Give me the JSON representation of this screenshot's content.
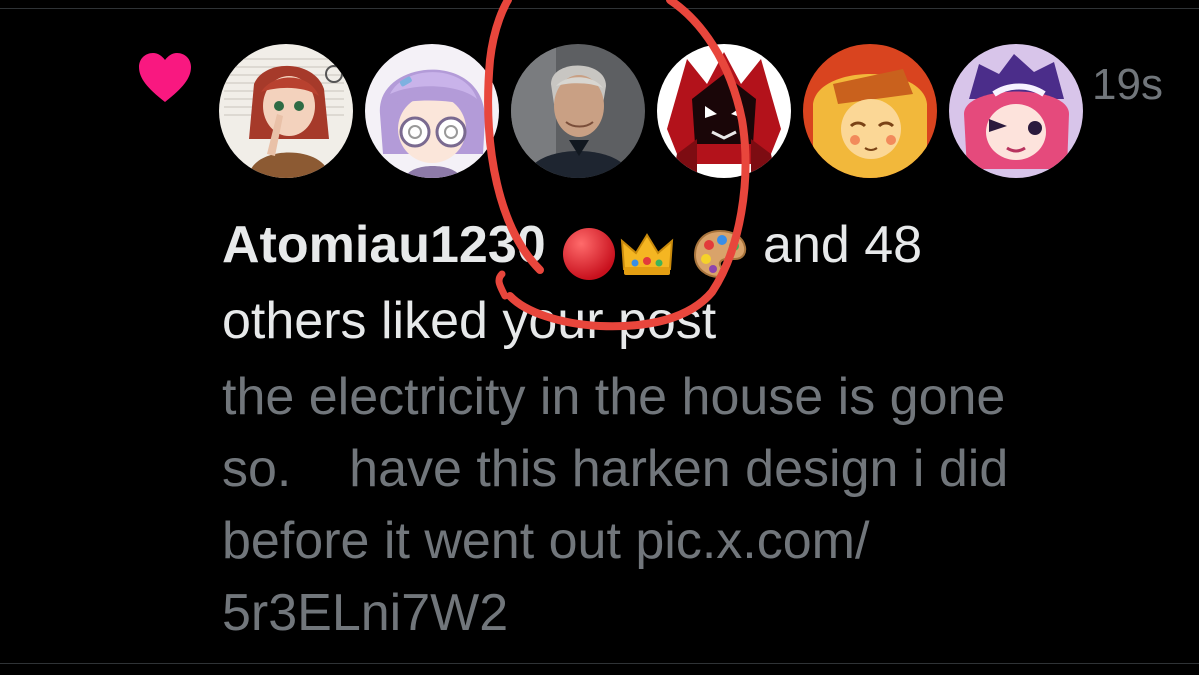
{
  "colors": {
    "background": "#000000",
    "heart": "#f91880",
    "primary_text": "#e7e9ea",
    "secondary_text": "#71767b",
    "annotation_red": "#e8463c"
  },
  "notification": {
    "icon": "heart-icon",
    "timestamp": "19s",
    "avatars": [
      {
        "name": "avatar-1",
        "description": "red-haired girl drawing"
      },
      {
        "name": "avatar-2",
        "description": "lavender-haired character with glasses"
      },
      {
        "name": "avatar-3",
        "description": "photo of a man"
      },
      {
        "name": "avatar-4",
        "description": "red dark character drawing"
      },
      {
        "name": "avatar-5",
        "description": "orange-haired character drawing"
      },
      {
        "name": "avatar-6",
        "description": "pink and purple character drawing"
      }
    ],
    "username": "Atomiau1230",
    "badges": [
      "red-circle-emoji",
      "crown-emoji",
      "artist-palette-emoji"
    ],
    "summary_tail": " and 48",
    "summary_line2": "others liked your post",
    "post_preview": "the electricity in the house is gone\nso.    have this harken design i did\nbefore it went out pic.x.com/\n5r3ELni7W2"
  }
}
